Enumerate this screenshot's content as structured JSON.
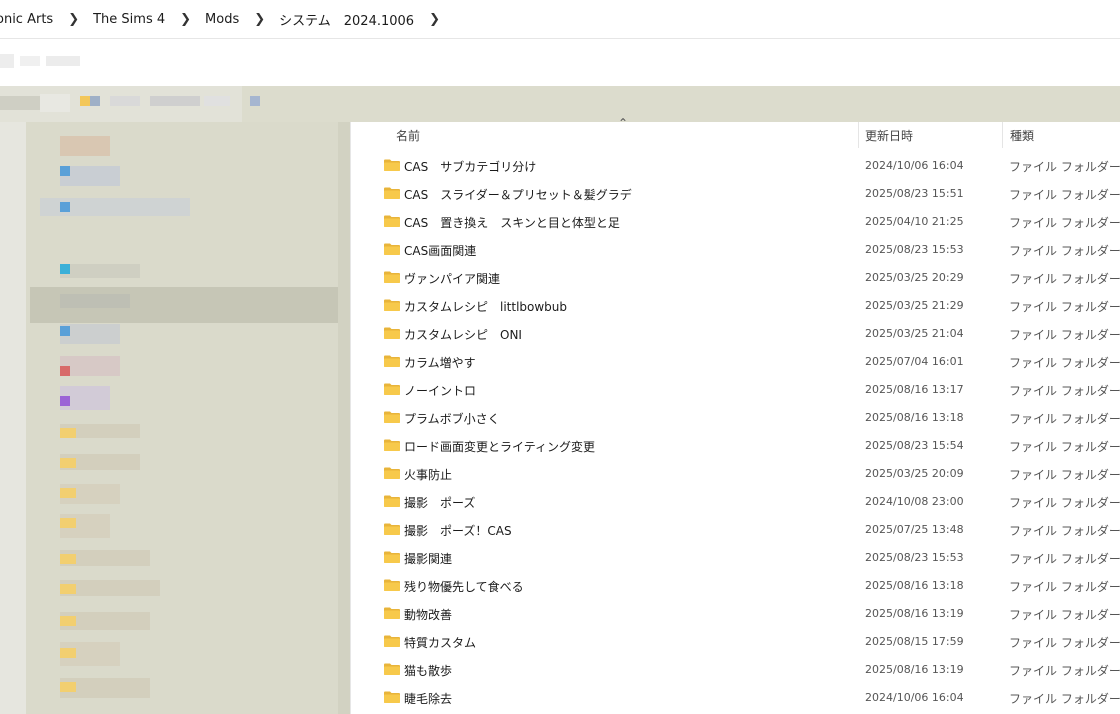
{
  "breadcrumb": [
    "onic Arts",
    "The Sims 4",
    "Mods",
    "システム　2024.1006"
  ],
  "columns": {
    "name": "名前",
    "date": "更新日時",
    "type": "種類"
  },
  "rows": [
    {
      "name": "CAS　サブカテゴリ分け",
      "date": "2024/10/06 16:04",
      "type": "ファイル フォルダー"
    },
    {
      "name": "CAS　スライダー＆プリセット＆髪グラデ",
      "date": "2025/08/23 15:51",
      "type": "ファイル フォルダー"
    },
    {
      "name": "CAS　置き換え　スキンと目と体型と足",
      "date": "2025/04/10 21:25",
      "type": "ファイル フォルダー"
    },
    {
      "name": "CAS画面関連",
      "date": "2025/08/23 15:53",
      "type": "ファイル フォルダー"
    },
    {
      "name": "ヴァンパイア関連",
      "date": "2025/03/25 20:29",
      "type": "ファイル フォルダー"
    },
    {
      "name": "カスタムレシピ　littlbowbub",
      "date": "2025/03/25 21:29",
      "type": "ファイル フォルダー"
    },
    {
      "name": "カスタムレシピ　ONI",
      "date": "2025/03/25 21:04",
      "type": "ファイル フォルダー"
    },
    {
      "name": "カラム増やす",
      "date": "2025/07/04 16:01",
      "type": "ファイル フォルダー"
    },
    {
      "name": "ノーイントロ",
      "date": "2025/08/16 13:17",
      "type": "ファイル フォルダー"
    },
    {
      "name": "プラムボブ小さく",
      "date": "2025/08/16 13:18",
      "type": "ファイル フォルダー"
    },
    {
      "name": "ロード画面変更とライティング変更",
      "date": "2025/08/23 15:54",
      "type": "ファイル フォルダー"
    },
    {
      "name": "火事防止",
      "date": "2025/03/25 20:09",
      "type": "ファイル フォルダー"
    },
    {
      "name": "撮影　ポーズ",
      "date": "2024/10/08 23:00",
      "type": "ファイル フォルダー"
    },
    {
      "name": "撮影　ポーズ！CAS",
      "date": "2025/07/25 13:48",
      "type": "ファイル フォルダー"
    },
    {
      "name": "撮影関連",
      "date": "2025/08/23 15:53",
      "type": "ファイル フォルダー"
    },
    {
      "name": "残り物優先して食べる",
      "date": "2025/08/16 13:18",
      "type": "ファイル フォルダー"
    },
    {
      "name": "動物改善",
      "date": "2025/08/16 13:19",
      "type": "ファイル フォルダー"
    },
    {
      "name": "特質カスタム",
      "date": "2025/08/15 17:59",
      "type": "ファイル フォルダー"
    },
    {
      "name": "猫も散歩",
      "date": "2025/08/16 13:19",
      "type": "ファイル フォルダー"
    },
    {
      "name": "睫毛除去",
      "date": "2024/10/06 16:04",
      "type": "ファイル フォルダー"
    }
  ],
  "icons": {
    "folder": "folder-icon",
    "chevron": "chevron-right-icon",
    "sort": "sort-up-icon"
  },
  "colors": {
    "folder_fill": "#f7c94b",
    "folder_tab": "#e8b43a",
    "nav_bg": "#dadacb"
  }
}
